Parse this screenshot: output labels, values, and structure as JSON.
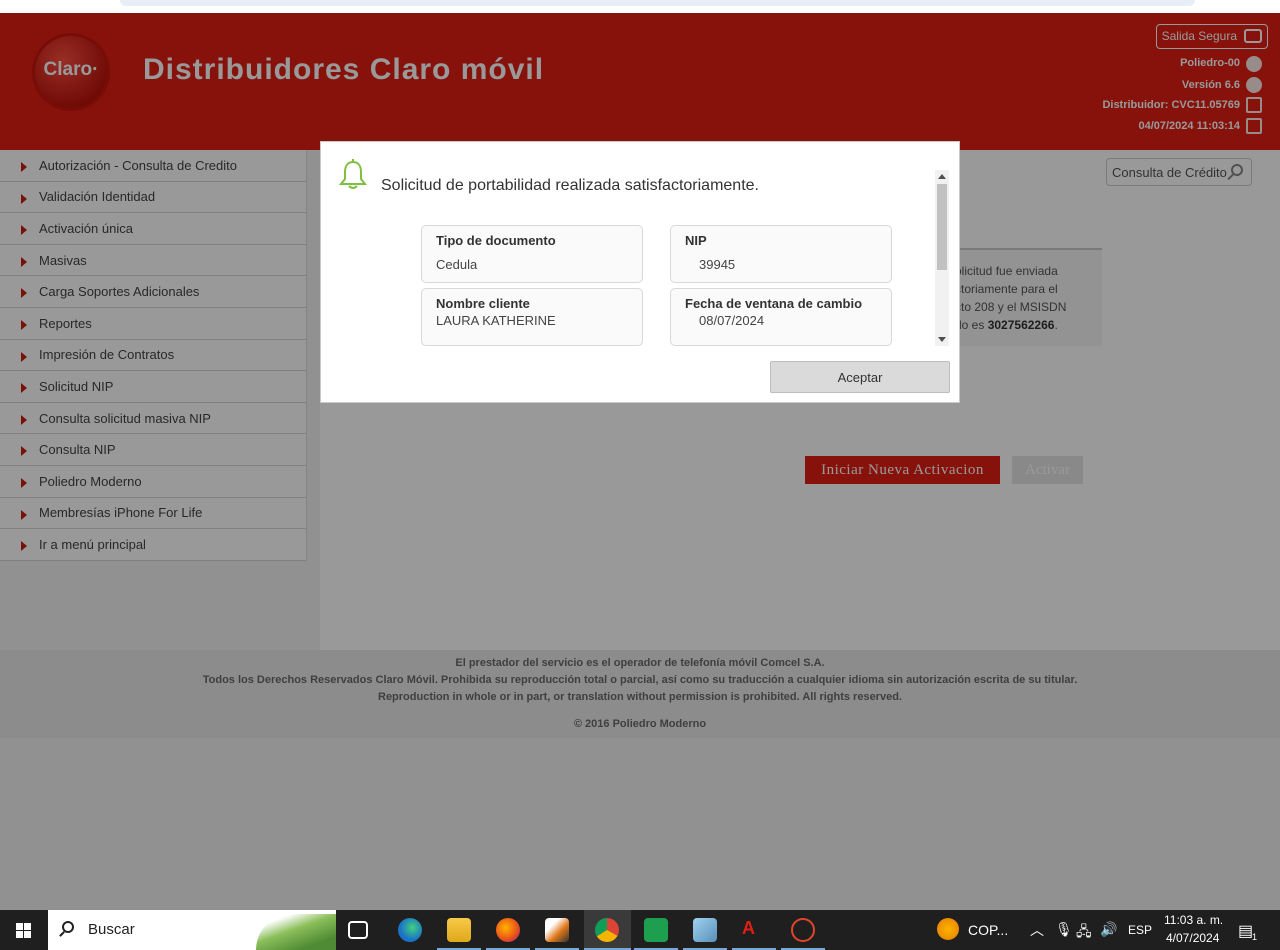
{
  "header": {
    "brand": "Claro·",
    "title": "Distribuidores Claro móvil",
    "safe_exit": "Salida Segura",
    "poliedro": "Poliedro-00",
    "version": "Versión 6.6",
    "distributor": "Distribuidor: CVC11.05769",
    "datetime": "04/07/2024 11:03:14"
  },
  "sidebar": {
    "items": [
      {
        "label": "Autorización - Consulta de Credito"
      },
      {
        "label": "Validación Identidad"
      },
      {
        "label": "Activación única"
      },
      {
        "label": "Masivas"
      },
      {
        "label": "Carga Soportes Adicionales"
      },
      {
        "label": "Reportes"
      },
      {
        "label": "Impresión de Contratos"
      },
      {
        "label": "Solicitud NIP"
      },
      {
        "label": "Consulta solicitud masiva NIP"
      },
      {
        "label": "Consulta NIP"
      },
      {
        "label": "Poliedro Moderno"
      },
      {
        "label": "Membresías iPhone For Life"
      },
      {
        "label": "Ir a menú principal"
      }
    ]
  },
  "main": {
    "credit_search": "Consulta de Crédito",
    "info_line1": "olicitud fue enviada",
    "info_line2": "ctoriamente para el",
    "info_line3": "cto 208 y el MSISDN",
    "info_line4_pre": "do es ",
    "info_msisdn": "3027562266",
    "info_line4_post": ".",
    "new_activation": "Iniciar Nueva Activacion",
    "activate": "Activar"
  },
  "footer": {
    "line1": "El prestador del servicio es el operador de telefonía móvil Comcel S.A.",
    "line2": "Todos los Derechos Reservados Claro Móvil. Prohibida su reproducción total o parcial, así como su traducción a cualquier idioma sin autorización escrita de su titular.",
    "line3": "Reproduction in whole or in part, or translation without permission is prohibited. All rights reserved.",
    "line4": "© 2016 Poliedro Moderno"
  },
  "modal": {
    "message": "Solicitud de portabilidad realizada satisfactoriamente.",
    "fields": [
      {
        "label": "Tipo de documento",
        "value": "Cedula"
      },
      {
        "label": "NIP",
        "value": "39945"
      },
      {
        "label": "Nombre cliente",
        "value": "LAURA KATHERINE"
      },
      {
        "label": "Fecha de ventana de cambio",
        "value": "08/07/2024"
      }
    ],
    "accept": "Aceptar"
  },
  "taskbar": {
    "search_placeholder": "Buscar",
    "currency": "COP...",
    "language": "ESP",
    "time": "11:03 a. m.",
    "date": "4/07/2024",
    "notifications": "1"
  },
  "colors": {
    "brand_red": "#e21e13",
    "bell_green": "#7fbf3f"
  }
}
